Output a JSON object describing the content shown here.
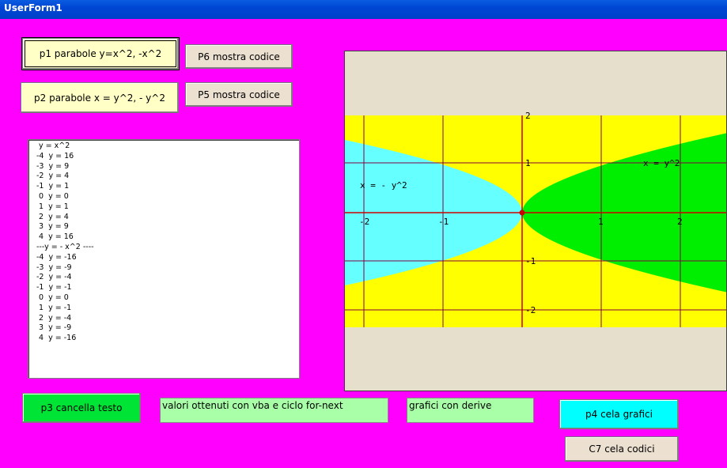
{
  "window": {
    "title": "UserForm1"
  },
  "buttons": {
    "p1": "p1 parabole y=x^2, -x^2",
    "p2": "p2 parabole x = y^2,  - y^2",
    "p6": "P6 mostra codice",
    "p5": "P5 mostra codice",
    "p3": "p3 cancella testo",
    "p4": "p4 cela grafici",
    "c7": "C7 cela codici"
  },
  "labels": {
    "vba": "valori ottenuti con vba e ciclo for-next",
    "derive": "grafici con derive"
  },
  "listbox": {
    "items": [
      " y = x^2",
      "-4  y = 16",
      "-3  y = 9",
      "-2  y = 4",
      "-1  y = 1",
      " 0  y = 0",
      " 1  y = 1",
      " 2  y = 4",
      " 3  y = 9",
      " 4  y = 16",
      "---y = - x^2 ----",
      "-4  y = -16",
      "-3  y = -9",
      "-2  y = -4",
      "-1  y = -1",
      " 0  y = 0",
      " 1  y = -1",
      " 2  y = -4",
      " 3  y = -9",
      " 4  y = -16"
    ]
  },
  "graph": {
    "curve_labels": {
      "right": "x = y^2",
      "left": "x = - y^2"
    },
    "x_ticks": [
      "-2",
      "-1",
      "1",
      "2"
    ],
    "y_ticks": [
      "2",
      "1",
      "-1",
      "-2"
    ],
    "colors": {
      "background": "#ffff00",
      "left_region": "#66ffff",
      "right_region": "#00ee00",
      "grid": "#800040",
      "origin": "#cc0000",
      "frame": "#e6dfcc"
    }
  }
}
